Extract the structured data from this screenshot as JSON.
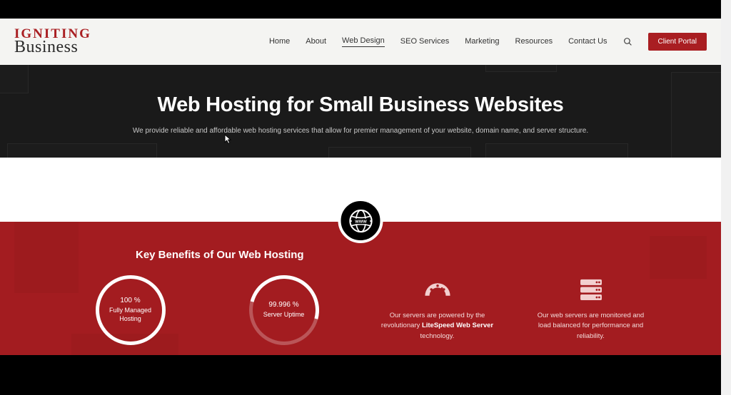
{
  "logo": {
    "line1": "IGNITING",
    "line2": "Business"
  },
  "nav": {
    "items": [
      {
        "label": "Home"
      },
      {
        "label": "About"
      },
      {
        "label": "Web Design"
      },
      {
        "label": "SEO Services"
      },
      {
        "label": "Marketing"
      },
      {
        "label": "Resources"
      },
      {
        "label": "Contact Us"
      }
    ],
    "activeIndex": 2,
    "client_portal": "Client Portal"
  },
  "hero": {
    "title": "Web Hosting for Small Business Websites",
    "subtitle": "We provide reliable and affordable web hosting services that allow for premier management of your website, domain name, and server structure."
  },
  "benefits": {
    "heading": "Key Benefits of Our Web Hosting",
    "ring1": {
      "percent": "100  %",
      "label_l1": "Fully Managed",
      "label_l2": "Hosting"
    },
    "ring2": {
      "percent": "99.996  %",
      "label": "Server Uptime"
    },
    "card3": {
      "text_before": "Our servers are powered by the revolutionary ",
      "bold": "LiteSpeed Web Server",
      "text_after": " technology."
    },
    "card4": {
      "text": "Our web servers are monitored and load balanced for performance and reliability."
    }
  }
}
